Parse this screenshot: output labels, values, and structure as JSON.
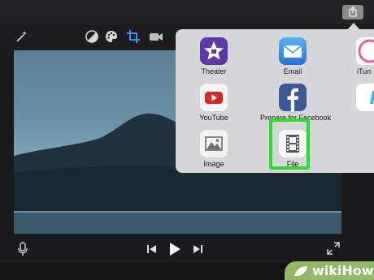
{
  "toolbar": {
    "tools": [
      "magic-wand-icon",
      "filter-icon",
      "palette-icon",
      "crop-icon",
      "camera-icon"
    ]
  },
  "share_menu": {
    "apps": [
      {
        "label": "Theater",
        "icon": "theater-star-icon",
        "color": "#5b3aa8"
      },
      {
        "label": "Email",
        "icon": "mail-envelope-icon",
        "color": "#2e8be6"
      },
      {
        "label": "iTun",
        "icon": "itunes-music-icon",
        "color": "#e85fa6"
      },
      {
        "label": "YouTube",
        "icon": "youtube-play-icon",
        "color": "#d82828"
      },
      {
        "label": "Prepare for Facebook",
        "icon": "facebook-f-icon",
        "color": "#3b5998"
      },
      {
        "label": "V",
        "icon": "vimeo-icon",
        "color": "#3fb6e6"
      },
      {
        "label": "Image",
        "icon": "image-mountain-icon",
        "color": "#6f6f6f"
      },
      {
        "label": "File",
        "icon": "film-strip-icon",
        "color": "#555555"
      }
    ],
    "highlighted": "File",
    "highlight_color": "#23e223"
  },
  "player": {
    "controls": [
      "microphone-icon",
      "skip-back-icon",
      "play-icon",
      "skip-forward-icon",
      "fullscreen-icon"
    ]
  },
  "watermark": {
    "part1": "wiki",
    "part2": "How"
  }
}
